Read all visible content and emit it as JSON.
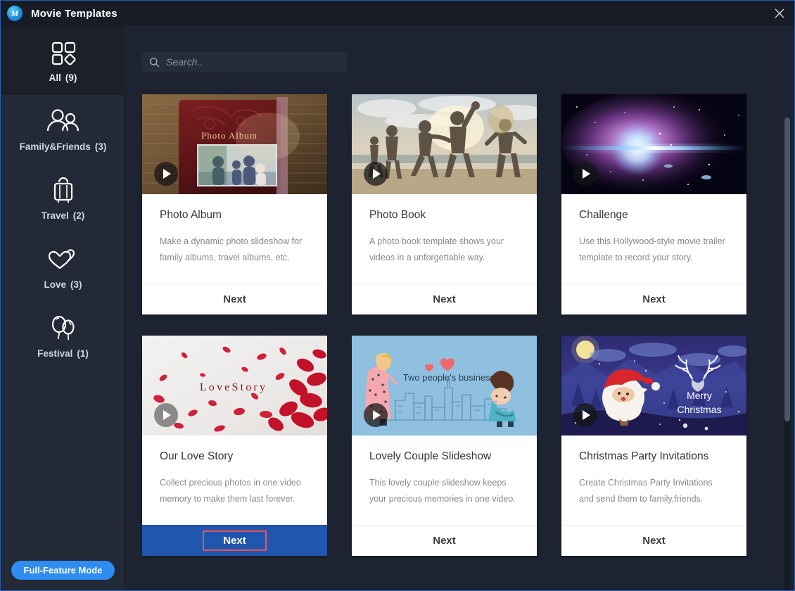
{
  "window": {
    "title": "Movie Templates",
    "logo_text": "M",
    "close_icon": "close-icon"
  },
  "sidebar": {
    "items": [
      {
        "label": "All",
        "count": "(9)",
        "icon": "grid-icon",
        "selected": true
      },
      {
        "label": "Family&Friends",
        "count": "(3)",
        "icon": "people-icon",
        "selected": false
      },
      {
        "label": "Travel",
        "count": "(2)",
        "icon": "luggage-icon",
        "selected": false
      },
      {
        "label": "Love",
        "count": "(3)",
        "icon": "hearts-icon",
        "selected": false
      },
      {
        "label": "Festival",
        "count": "(1)",
        "icon": "balloons-icon",
        "selected": false
      }
    ],
    "full_feature_button": "Full-Feature Mode"
  },
  "search": {
    "placeholder": "Search..",
    "value": "",
    "icon": "search-icon"
  },
  "templates": [
    {
      "title": "Photo Album",
      "description": "Make a dynamic photo slideshow for family albums, travel albums, etc.",
      "next_label": "Next",
      "thumb_caption": "Photo Album",
      "selected": false
    },
    {
      "title": "Photo Book",
      "description": "A photo book template shows your videos in a unforgettable way.",
      "next_label": "Next",
      "thumb_caption": "",
      "selected": false
    },
    {
      "title": "Challenge",
      "description": "Use this Hollywood-style movie trailer template to record your story.",
      "next_label": "Next",
      "thumb_caption": "",
      "selected": false
    },
    {
      "title": "Our Love Story",
      "description": "Collect precious photos in one video memory to make them last forever.",
      "next_label": "Next",
      "thumb_caption": "L o v e S t o r y",
      "selected": true
    },
    {
      "title": "Lovely Couple Slideshow",
      "description": "This lovely couple slideshow keeps your precious memories in one video.",
      "next_label": "Next",
      "thumb_caption": "Two people's business",
      "selected": false
    },
    {
      "title": "Christmas Party Invitations",
      "description": "Create Christmas Party Invitations and send them to family,friends.",
      "next_label": "Next",
      "thumb_caption": "Merry Christmas",
      "selected": false
    }
  ],
  "colors": {
    "accent_blue": "#2f8cf0",
    "selection_red": "#f4504f",
    "active_next_bg": "#2056ae",
    "window_bg": "#1d2330",
    "sidebar_bg": "#232937"
  }
}
